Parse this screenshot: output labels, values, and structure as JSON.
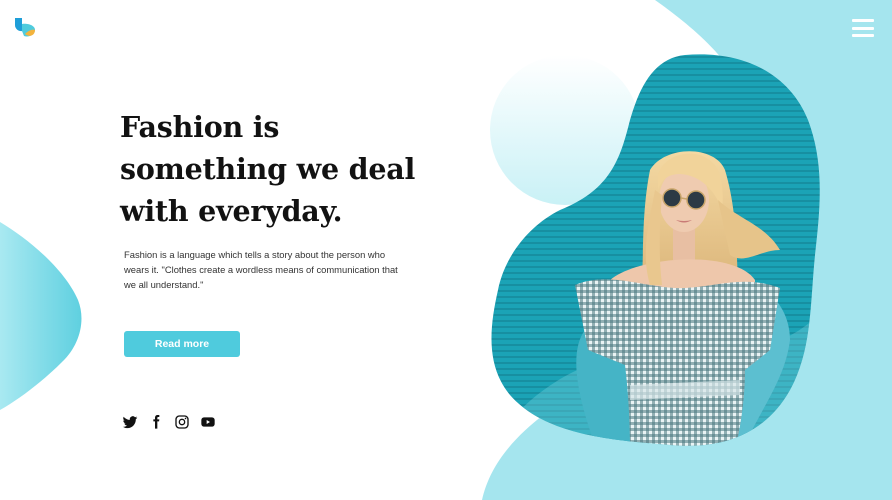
{
  "hero": {
    "headline": "Fashion is\nsomething we deal\nwith everyday.",
    "description": "Fashion is a language which tells a story about the person who wears it. \"Clothes create a wordless means of communication that we all understand.\"",
    "cta_label": "Read more"
  },
  "header": {
    "logo_icon": "logo-icon",
    "menu_icon": "hamburger-menu-icon"
  },
  "social": [
    {
      "icon": "twitter-icon"
    },
    {
      "icon": "facebook-icon"
    },
    {
      "icon": "instagram-icon"
    },
    {
      "icon": "youtube-icon"
    }
  ],
  "colors": {
    "accent": "#4fcbdd",
    "light_aqua": "#a8e6ee",
    "deep_teal": "#1aa6b9",
    "text": "#121212"
  }
}
